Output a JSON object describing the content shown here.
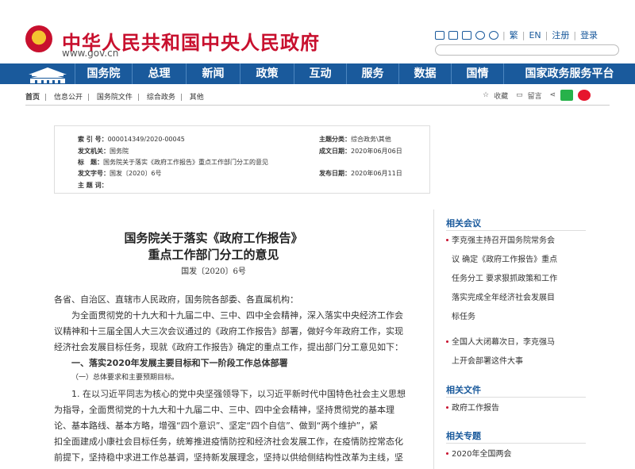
{
  "header": {
    "site_title": "中华人民共和国中央人民政府",
    "site_url": "www.gov.cn",
    "lang_traditional": "繁",
    "lang_en": "EN",
    "register": "注册",
    "login": "登录"
  },
  "nav": {
    "items": [
      "国务院",
      "总理",
      "新闻",
      "政策",
      "互动",
      "服务",
      "数据",
      "国情",
      "国家政务服务平台"
    ]
  },
  "breadcrumb": {
    "items": [
      "首页",
      "信息公开",
      "国务院文件",
      "综合政务",
      "其他"
    ],
    "favorite": "收藏",
    "comment": "留言"
  },
  "info": {
    "index_label": "索 引 号：",
    "index_value": "000014349/2020-00045",
    "org_label": "发文机关：",
    "org_value": "国务院",
    "title_label": "标　题：",
    "title_value": "国务院关于落实《政府工作报告》重点工作部门分工的意见",
    "docno_label": "发文字号：",
    "docno_value": "国发〔2020〕6号",
    "subject_label": "主 题 词：",
    "subject_value": "",
    "category_label": "主题分类：",
    "category_value": "综合政务\\其他",
    "written_label": "成文日期：",
    "written_value": "2020年06月06日",
    "published_label": "发布日期：",
    "published_value": "2020年06月11日"
  },
  "article": {
    "title_line1": "国务院关于落实《政府工作报告》",
    "title_line2": "重点工作部门分工的意见",
    "doc_no": "国发〔2020〕6号",
    "recipients": "各省、自治区、直辖市人民政府，国务院各部委、各直属机构：",
    "p1_l1": "为全面贯彻党的十九大和十九届二中、三中、四中全会精神，深入落实中央经济工作会",
    "p1_l2": "议精神和十三届全国人大三次会议通过的《政府工作报告》部署，做好今年政府工作，实现",
    "p1_l3": "经济社会发展目标任务，现就《政府工作报告》确定的重点工作，提出部门分工意见如下：",
    "section1": "一、落实2020年发展主要目标和下一阶段工作总体部署",
    "sub1": "（一）总体要求和主要预期目标。",
    "p2_l1": "1. 在以习近平同志为核心的党中央坚强领导下，以习近平新时代中国特色社会主义思想",
    "p2_l2": "为指导，全面贯彻党的十九大和十九届二中、三中、四中全会精神，坚持贯彻党的基本理",
    "p2_l3": "论、基本路线、基本方略，增强“四个意识”、坚定“四个自信”、做到“两个维护”，紧",
    "p2_l4": "扣全面建成小康社会目标任务，统筹推进疫情防控和经济社会发展工作，在疫情防控常态化",
    "p2_l5": "前提下，坚持稳中求进工作总基调，坚持新发展理念，坚持以供给侧结构性改革为主线，坚"
  },
  "sidebar": {
    "meetings_title": "相关会议",
    "meeting1_l1": "李克强主持召开国务院常务会",
    "meeting1_l2": "议 确定《政府工作报告》重点",
    "meeting1_l3": "任务分工 要求狠抓政策和工作",
    "meeting1_l4": "落实完成全年经济社会发展目",
    "meeting1_l5": "标任务",
    "meeting2_l1": "全国人大闭幕次日，李克强马",
    "meeting2_l2": "上开会部署这件大事",
    "files_title": "相关文件",
    "file1": "政府工作报告",
    "topics_title": "相关专题",
    "topic1": "2020年全国两会"
  },
  "colors": {
    "brand_red": "#c8102e",
    "nav_blue": "#1a5a9c"
  }
}
